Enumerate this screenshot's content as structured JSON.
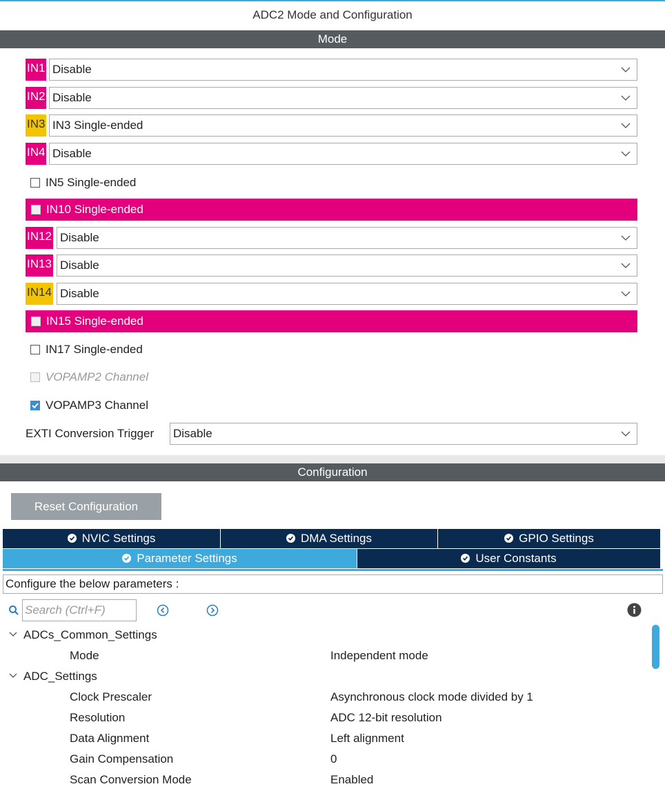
{
  "window": {
    "title": "ADC2 Mode and Configuration"
  },
  "mode": {
    "header": "Mode",
    "pins": [
      {
        "label": "IN1",
        "value": "Disable",
        "color": "#e4007c"
      },
      {
        "label": "IN2",
        "value": "Disable",
        "color": "#e4007c"
      },
      {
        "label": "IN3",
        "value": "IN3 Single-ended",
        "color": "#f5c400"
      },
      {
        "label": "IN4",
        "value": "Disable",
        "color": "#e4007c"
      }
    ],
    "in5": "IN5 Single-ended",
    "in10": "IN10 Single-ended",
    "pins2": [
      {
        "label": "IN12",
        "value": "Disable",
        "color": "#e4007c"
      },
      {
        "label": "IN13",
        "value": "Disable",
        "color": "#e4007c"
      },
      {
        "label": "IN14",
        "value": "Disable",
        "color": "#f5c400"
      }
    ],
    "in15": "IN15 Single-ended",
    "in17": "IN17 Single-ended",
    "vopamp2": "VOPAMP2 Channel",
    "vopamp3": "VOPAMP3 Channel",
    "exti_label": "EXTI Conversion Trigger",
    "exti_value": "Disable"
  },
  "config": {
    "header": "Configuration",
    "reset_label": "Reset Configuration",
    "tabs_row1": [
      "NVIC Settings",
      "DMA Settings",
      "GPIO Settings"
    ],
    "tabs_row2": [
      "Parameter Settings",
      "User Constants"
    ],
    "description": "Configure the below parameters :",
    "search_placeholder": "Search (Ctrl+F)",
    "groups": [
      {
        "name": "ADCs_Common_Settings",
        "params": [
          {
            "name": "Mode",
            "value": "Independent mode"
          }
        ]
      },
      {
        "name": "ADC_Settings",
        "params": [
          {
            "name": "Clock Prescaler",
            "value": "Asynchronous clock mode divided by 1"
          },
          {
            "name": "Resolution",
            "value": "ADC 12-bit resolution"
          },
          {
            "name": "Data Alignment",
            "value": "Left alignment"
          },
          {
            "name": "Gain Compensation",
            "value": "0"
          },
          {
            "name": "Scan Conversion Mode",
            "value": "Enabled"
          }
        ]
      }
    ]
  },
  "colors": {
    "accent": "#3ea9dc",
    "navy": "#0b2a4f",
    "magenta": "#e4007c",
    "yellow": "#f5c400"
  }
}
